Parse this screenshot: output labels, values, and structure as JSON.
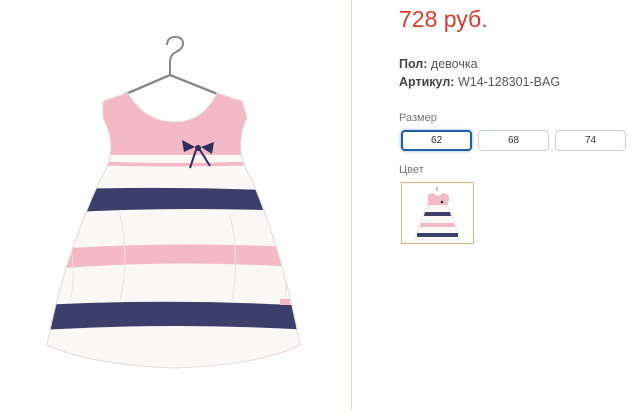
{
  "product": {
    "price": "728 руб.",
    "gender_label": "Пол:",
    "gender_value": "девочка",
    "sku_label": "Артикул:",
    "sku_value": "W14-128301-BAG"
  },
  "size_section": {
    "label": "Размер",
    "options": [
      "62",
      "68",
      "74"
    ],
    "selected": "62"
  },
  "color_section": {
    "label": "Цвет"
  },
  "colors": {
    "price": "#e03a2b",
    "selected_border": "#1f5fa8",
    "divider": "#f1d3b6",
    "dress_pink": "#f4b9c6",
    "dress_navy": "#3d3f6b",
    "dress_white": "#faf7f7"
  }
}
